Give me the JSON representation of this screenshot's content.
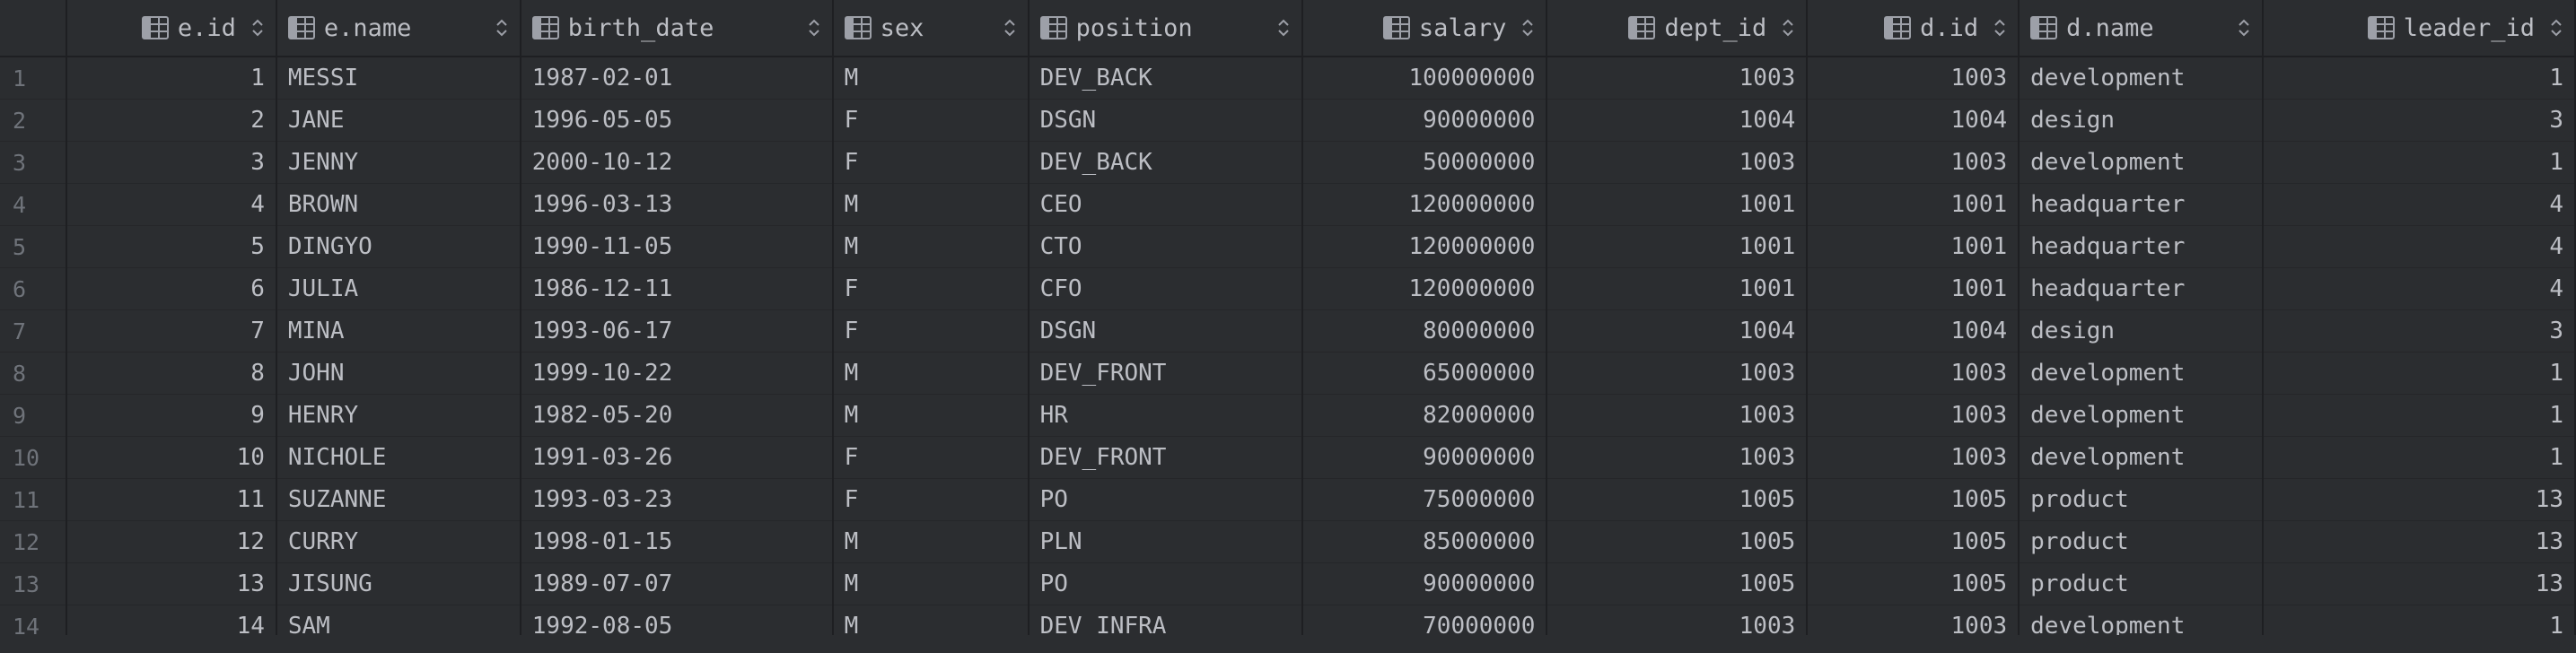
{
  "columns": [
    {
      "label": "e.id",
      "align": "num"
    },
    {
      "label": "e.name",
      "align": "txt"
    },
    {
      "label": "birth_date",
      "align": "txt"
    },
    {
      "label": "sex",
      "align": "txt"
    },
    {
      "label": "position",
      "align": "txt"
    },
    {
      "label": "salary",
      "align": "num"
    },
    {
      "label": "dept_id",
      "align": "num"
    },
    {
      "label": "d.id",
      "align": "num"
    },
    {
      "label": "d.name",
      "align": "txt"
    },
    {
      "label": "leader_id",
      "align": "num"
    }
  ],
  "rows": [
    [
      "1",
      "1",
      "MESSI",
      "1987-02-01",
      "M",
      "DEV_BACK",
      "100000000",
      "1003",
      "1003",
      "development",
      "1"
    ],
    [
      "2",
      "2",
      "JANE",
      "1996-05-05",
      "F",
      "DSGN",
      "90000000",
      "1004",
      "1004",
      "design",
      "3"
    ],
    [
      "3",
      "3",
      "JENNY",
      "2000-10-12",
      "F",
      "DEV_BACK",
      "50000000",
      "1003",
      "1003",
      "development",
      "1"
    ],
    [
      "4",
      "4",
      "BROWN",
      "1996-03-13",
      "M",
      "CEO",
      "120000000",
      "1001",
      "1001",
      "headquarter",
      "4"
    ],
    [
      "5",
      "5",
      "DINGYO",
      "1990-11-05",
      "M",
      "CTO",
      "120000000",
      "1001",
      "1001",
      "headquarter",
      "4"
    ],
    [
      "6",
      "6",
      "JULIA",
      "1986-12-11",
      "F",
      "CFO",
      "120000000",
      "1001",
      "1001",
      "headquarter",
      "4"
    ],
    [
      "7",
      "7",
      "MINA",
      "1993-06-17",
      "F",
      "DSGN",
      "80000000",
      "1004",
      "1004",
      "design",
      "3"
    ],
    [
      "8",
      "8",
      "JOHN",
      "1999-10-22",
      "M",
      "DEV_FRONT",
      "65000000",
      "1003",
      "1003",
      "development",
      "1"
    ],
    [
      "9",
      "9",
      "HENRY",
      "1982-05-20",
      "M",
      "HR",
      "82000000",
      "1003",
      "1003",
      "development",
      "1"
    ],
    [
      "10",
      "10",
      "NICHOLE",
      "1991-03-26",
      "F",
      "DEV_FRONT",
      "90000000",
      "1003",
      "1003",
      "development",
      "1"
    ],
    [
      "11",
      "11",
      "SUZANNE",
      "1993-03-23",
      "F",
      "PO",
      "75000000",
      "1005",
      "1005",
      "product",
      "13"
    ],
    [
      "12",
      "12",
      "CURRY",
      "1998-01-15",
      "M",
      "PLN",
      "85000000",
      "1005",
      "1005",
      "product",
      "13"
    ],
    [
      "13",
      "13",
      "JISUNG",
      "1989-07-07",
      "M",
      "PO",
      "90000000",
      "1005",
      "1005",
      "product",
      "13"
    ],
    [
      "14",
      "14",
      "SAM",
      "1992-08-05",
      "M",
      "DEV_INFRA",
      "70000000",
      "1003",
      "1003",
      "development",
      "1"
    ]
  ],
  "icons": {
    "column": "table-column-icon",
    "sort": "sort-arrows-icon"
  }
}
